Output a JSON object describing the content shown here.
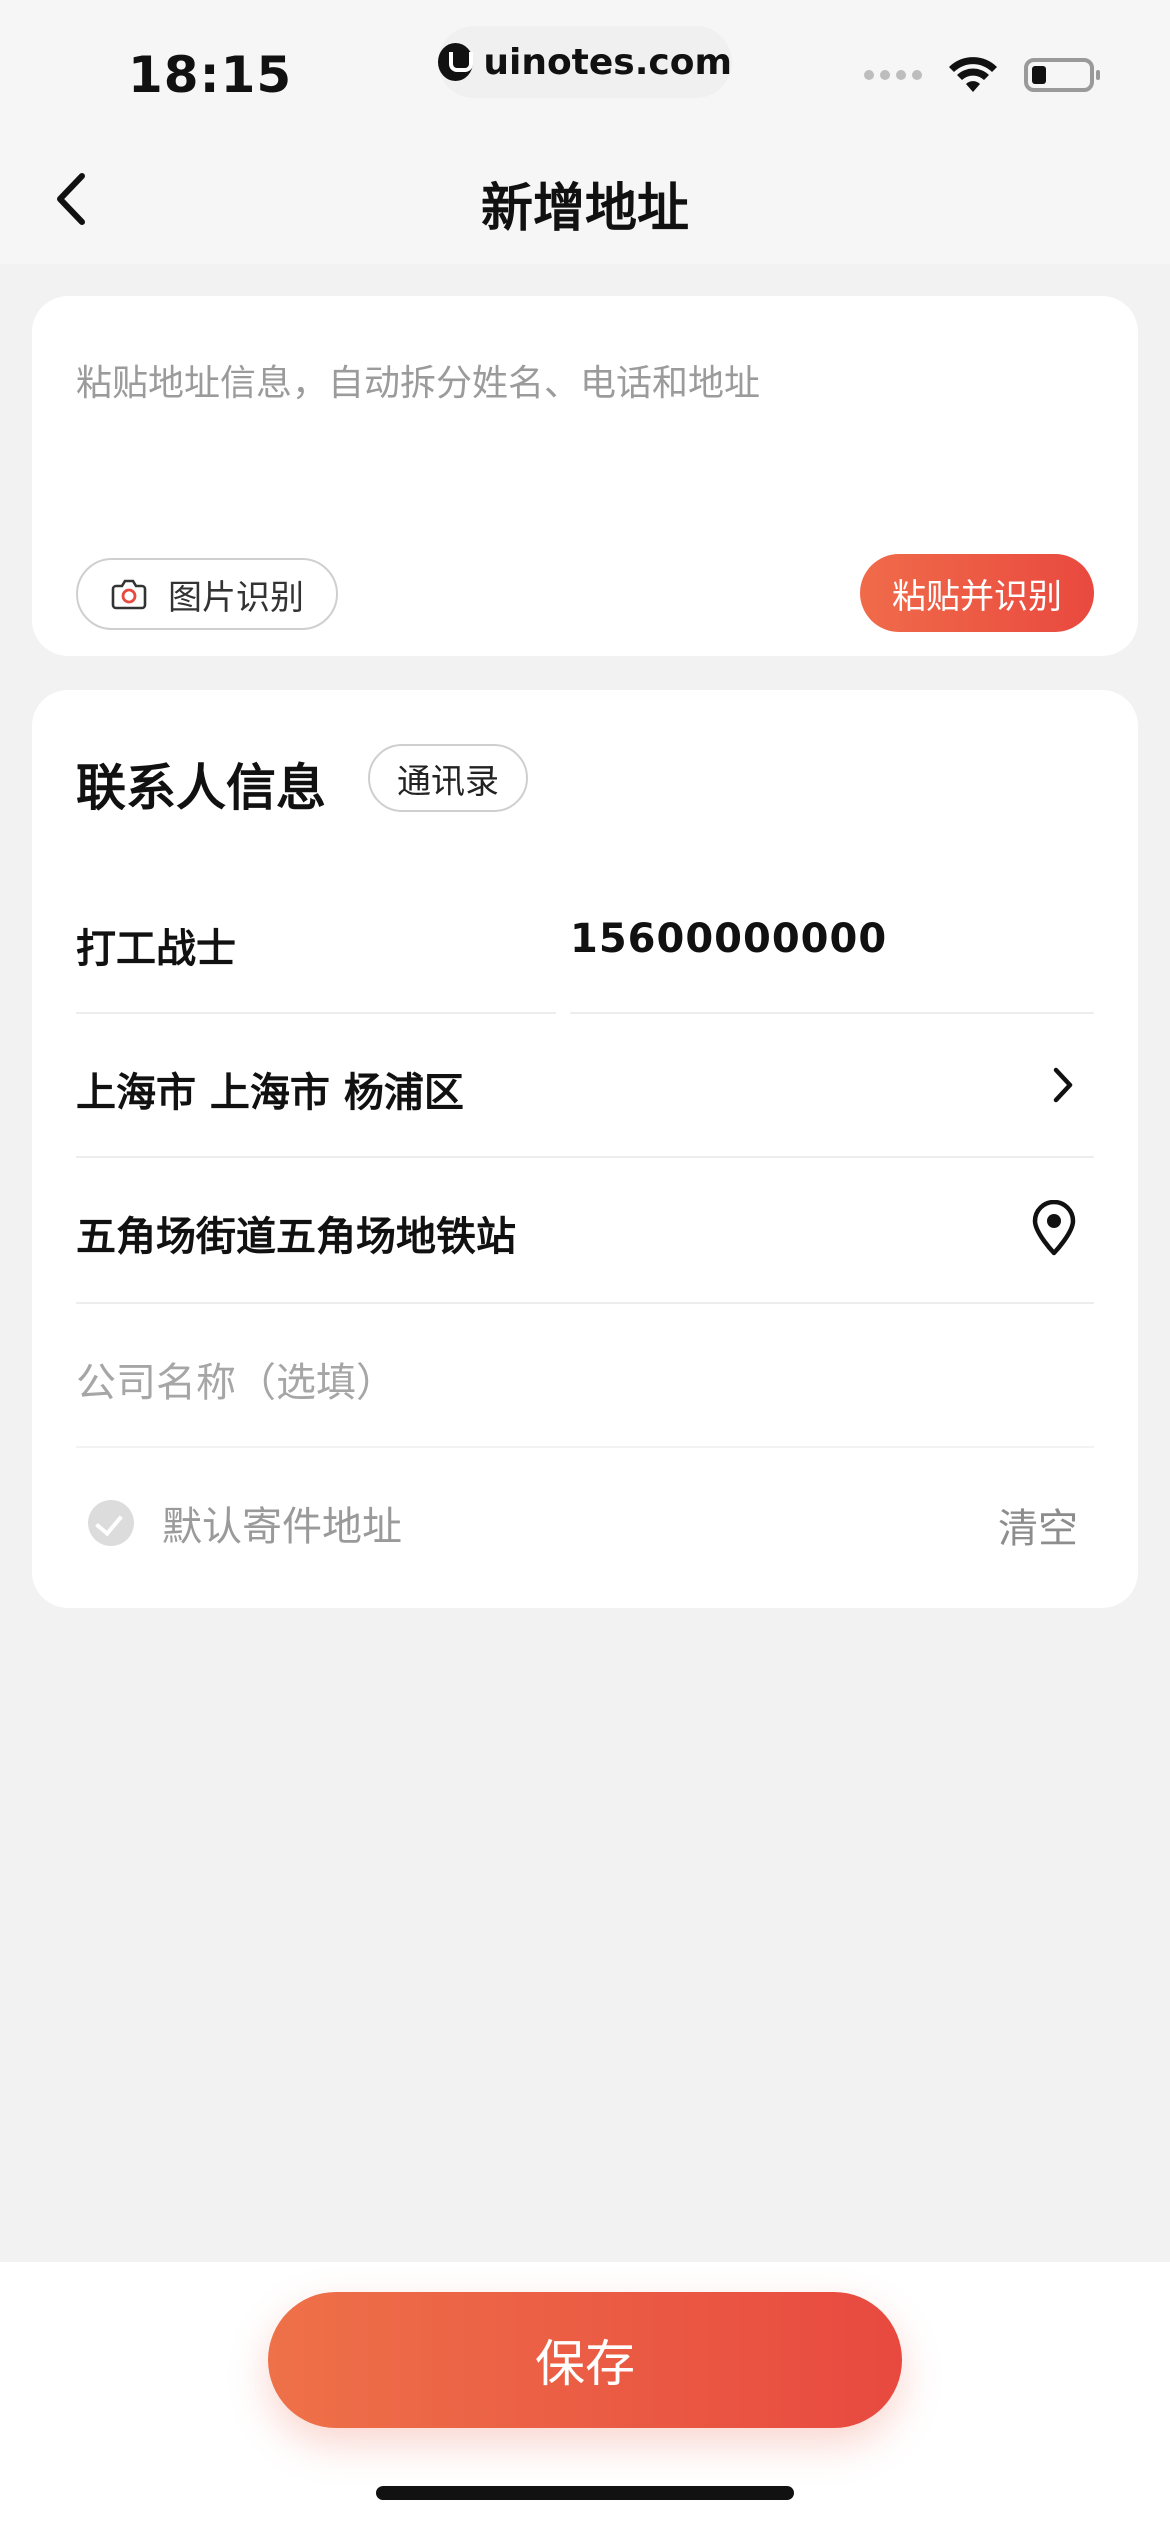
{
  "status_bar": {
    "time": "18:15",
    "url": "uinotes.com"
  },
  "header": {
    "title": "新增地址"
  },
  "paste_card": {
    "placeholder": "粘贴地址信息，自动拆分姓名、电话和地址",
    "image_recognize_label": "图片识别",
    "paste_recognize_label": "粘贴并识别"
  },
  "contact_card": {
    "title": "联系人信息",
    "contacts_button": "通讯录",
    "name": "打工战士",
    "phone": "15600000000",
    "region": "上海市 上海市 杨浦区",
    "detail_address": "五角场街道五角场地铁站",
    "company_placeholder": "公司名称（选填）",
    "default_label": "默认寄件地址",
    "clear_label": "清空"
  },
  "footer": {
    "save_label": "保存"
  },
  "colors": {
    "accent": "#EA5540",
    "background": "#F2F2F2"
  }
}
